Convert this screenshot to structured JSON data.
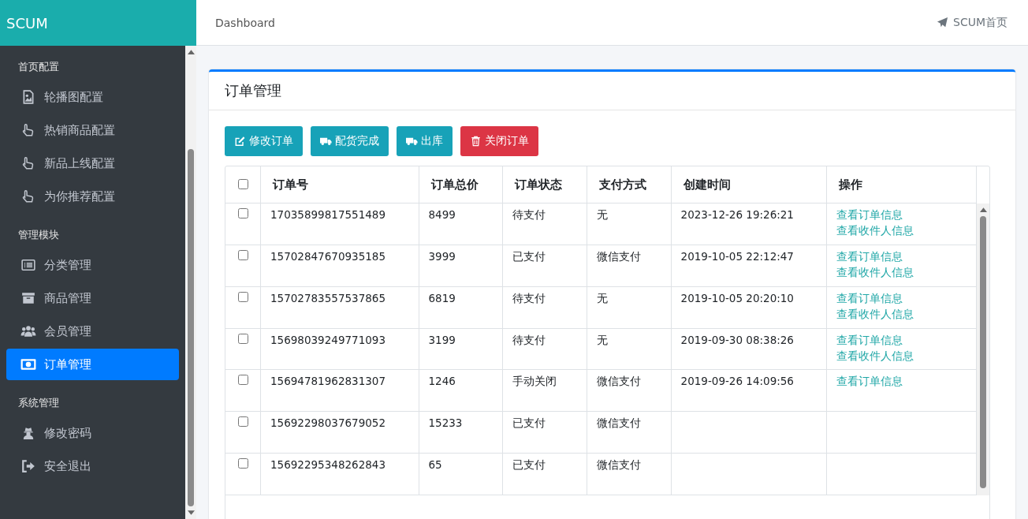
{
  "brand": "SCUM",
  "sidebar": {
    "groups": [
      {
        "heading": "首页配置",
        "items": [
          {
            "label": "轮播图配置",
            "kind": "image",
            "selected": false
          },
          {
            "label": "热销商品配置",
            "kind": "hand",
            "selected": false
          },
          {
            "label": "新品上线配置",
            "kind": "hand",
            "selected": false
          },
          {
            "label": "为你推荐配置",
            "kind": "hand",
            "selected": false
          }
        ]
      },
      {
        "heading": "管理模块",
        "items": [
          {
            "label": "分类管理",
            "kind": "list",
            "selected": false
          },
          {
            "label": "商品管理",
            "kind": "archive",
            "selected": false
          },
          {
            "label": "会员管理",
            "kind": "users",
            "selected": false
          },
          {
            "label": "订单管理",
            "kind": "money",
            "selected": true
          }
        ]
      },
      {
        "heading": "系统管理",
        "items": [
          {
            "label": "修改密码",
            "kind": "spy",
            "selected": false
          },
          {
            "label": "安全退出",
            "kind": "exit",
            "selected": false
          }
        ]
      }
    ]
  },
  "topbar": {
    "breadcrumb": "Dashboard",
    "home_link": "SCUM首页"
  },
  "card": {
    "title": "订单管理",
    "buttons": [
      {
        "label": "修改订单",
        "kind": "edit"
      },
      {
        "label": "配货完成",
        "kind": "truck"
      },
      {
        "label": "出库",
        "kind": "truck"
      },
      {
        "label": "关闭订单",
        "kind": "trash"
      }
    ],
    "table": {
      "columns": [
        "订单号",
        "订单总价",
        "订单状态",
        "支付方式",
        "创建时间",
        "操作"
      ],
      "select_all_checked": false,
      "rows": [
        {
          "checked": false,
          "order_no": "17035899817551489",
          "total": "8499",
          "status": "待支付",
          "payment": "无",
          "created": "2023-12-26 19:26:21",
          "links": [
            "查看订单信息",
            "查看收件人信息"
          ]
        },
        {
          "checked": false,
          "order_no": "15702847670935185",
          "total": "3999",
          "status": "已支付",
          "payment": "微信支付",
          "created": "2019-10-05 22:12:47",
          "links": [
            "查看订单信息",
            "查看收件人信息"
          ]
        },
        {
          "checked": false,
          "order_no": "15702783557537865",
          "total": "6819",
          "status": "待支付",
          "payment": "无",
          "created": "2019-10-05 20:20:10",
          "links": [
            "查看订单信息",
            "查看收件人信息"
          ]
        },
        {
          "checked": false,
          "order_no": "15698039249771093",
          "total": "3199",
          "status": "待支付",
          "payment": "无",
          "created": "2019-09-30 08:38:26",
          "links": [
            "查看订单信息",
            "查看收件人信息"
          ]
        },
        {
          "checked": false,
          "order_no": "15694781962831307",
          "total": "1246",
          "status": "手动关闭",
          "payment": "微信支付",
          "created": "2019-09-26 14:09:56",
          "links": [
            "查看订单信息"
          ]
        },
        {
          "checked": false,
          "order_no": "15692298037679052",
          "total": "15233",
          "status": "已支付",
          "payment": "微信支付",
          "links": []
        },
        {
          "checked": false,
          "order_no": "15692295348262843",
          "total": "65",
          "status": "已支付",
          "payment": "微信支付",
          "links": []
        }
      ]
    }
  }
}
